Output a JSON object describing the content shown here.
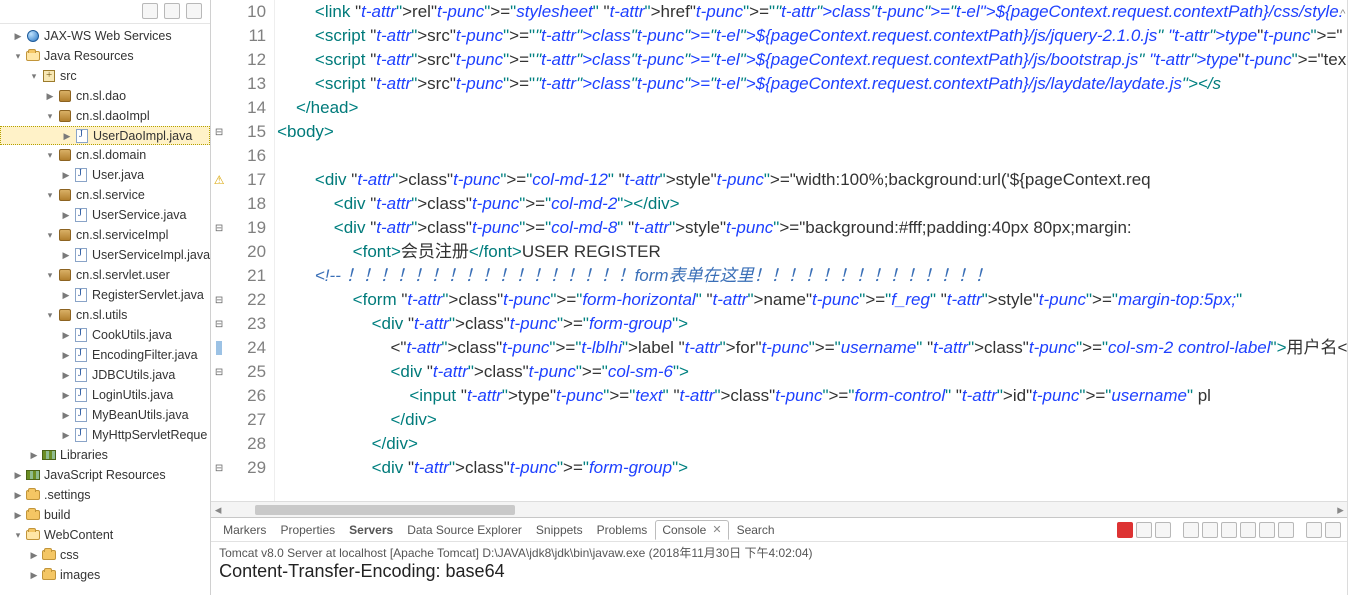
{
  "tree": {
    "jaxws": "JAX-WS Web Services",
    "javaRes": "Java Resources",
    "src": "src",
    "pkg_dao": "cn.sl.dao",
    "pkg_daoImpl": "cn.sl.daoImpl",
    "file_userDaoImpl": "UserDaoImpl.java",
    "pkg_domain": "cn.sl.domain",
    "file_user": "User.java",
    "pkg_service": "cn.sl.service",
    "file_userService": "UserService.java",
    "pkg_serviceImpl": "cn.sl.serviceImpl",
    "file_userServiceImpl": "UserServiceImpl.java",
    "pkg_servletUser": "cn.sl.servlet.user",
    "file_registerServlet": "RegisterServlet.java",
    "pkg_utils": "cn.sl.utils",
    "file_cookUtils": "CookUtils.java",
    "file_encodingFilter": "EncodingFilter.java",
    "file_jdbcUtils": "JDBCUtils.java",
    "file_loginUtils": "LoginUtils.java",
    "file_myBeanUtils": "MyBeanUtils.java",
    "file_myHttpServletReque": "MyHttpServletReque",
    "libraries": "Libraries",
    "jsResources": "JavaScript Resources",
    "settings": ".settings",
    "build": "build",
    "webContent": "WebContent",
    "css": "css",
    "images": "images"
  },
  "editor": {
    "firstLine": 10,
    "lines": [
      "        <link rel=\"stylesheet\" href=\"${pageContext.request.contextPath}/css/style.",
      "        <script src=\"${pageContext.request.contextPath}/js/jquery-2.1.0.js\" type=\"",
      "        <script src=\"${pageContext.request.contextPath}/js/bootstrap.js\" type=\"tex",
      "        <script src=\"${pageContext.request.contextPath}/js/laydate/laydate.js\"></s",
      "    </head>",
      "<body>",
      "",
      "        <div class=\"col-md-12\" style=\"width:100%;background:url('${pageContext.req",
      "            <div class=\"col-md-2\"></div>",
      "            <div class=\"col-md-8\" style=\"background:#fff;padding:40px 80px;margin:",
      "                <font>会员注册</font>USER REGISTER",
      "        <!-- ！！！！！！！！！！！！！！！！！form表单在这里！！！！！！！！！！！！！！",
      "                <form class=\"form-horizontal\" name=\"f_reg\" style=\"margin-top:5px;\"",
      "                    <div class=\"form-group\">",
      "                        <label for=\"username\" class=\"col-sm-2 control-label\">用户名<",
      "                        <div class=\"col-sm-6\">",
      "                            <input type=\"text\" class=\"form-control\" id=\"username\" pl",
      "                        </div>",
      "                    </div>",
      "                    <div class=\"form-group\">"
    ],
    "markers": {
      "15": "collapse",
      "17": "warning",
      "19": "collapse",
      "22": "collapse",
      "23": "collapse",
      "24": "current",
      "25": "collapse",
      "29": "collapse"
    }
  },
  "bottomTabs": {
    "markers": "Markers",
    "properties": "Properties",
    "servers": "Servers",
    "dse": "Data Source Explorer",
    "snippets": "Snippets",
    "problems": "Problems",
    "console": "Console",
    "search": "Search"
  },
  "console": {
    "title": "Tomcat v8.0 Server at localhost [Apache Tomcat] D:\\JAVA\\jdk8\\jdk\\bin\\javaw.exe (2018年11月30日 下午4:02:04)",
    "line": "Content-Transfer-Encoding: base64"
  },
  "scrollIndicator": "^"
}
